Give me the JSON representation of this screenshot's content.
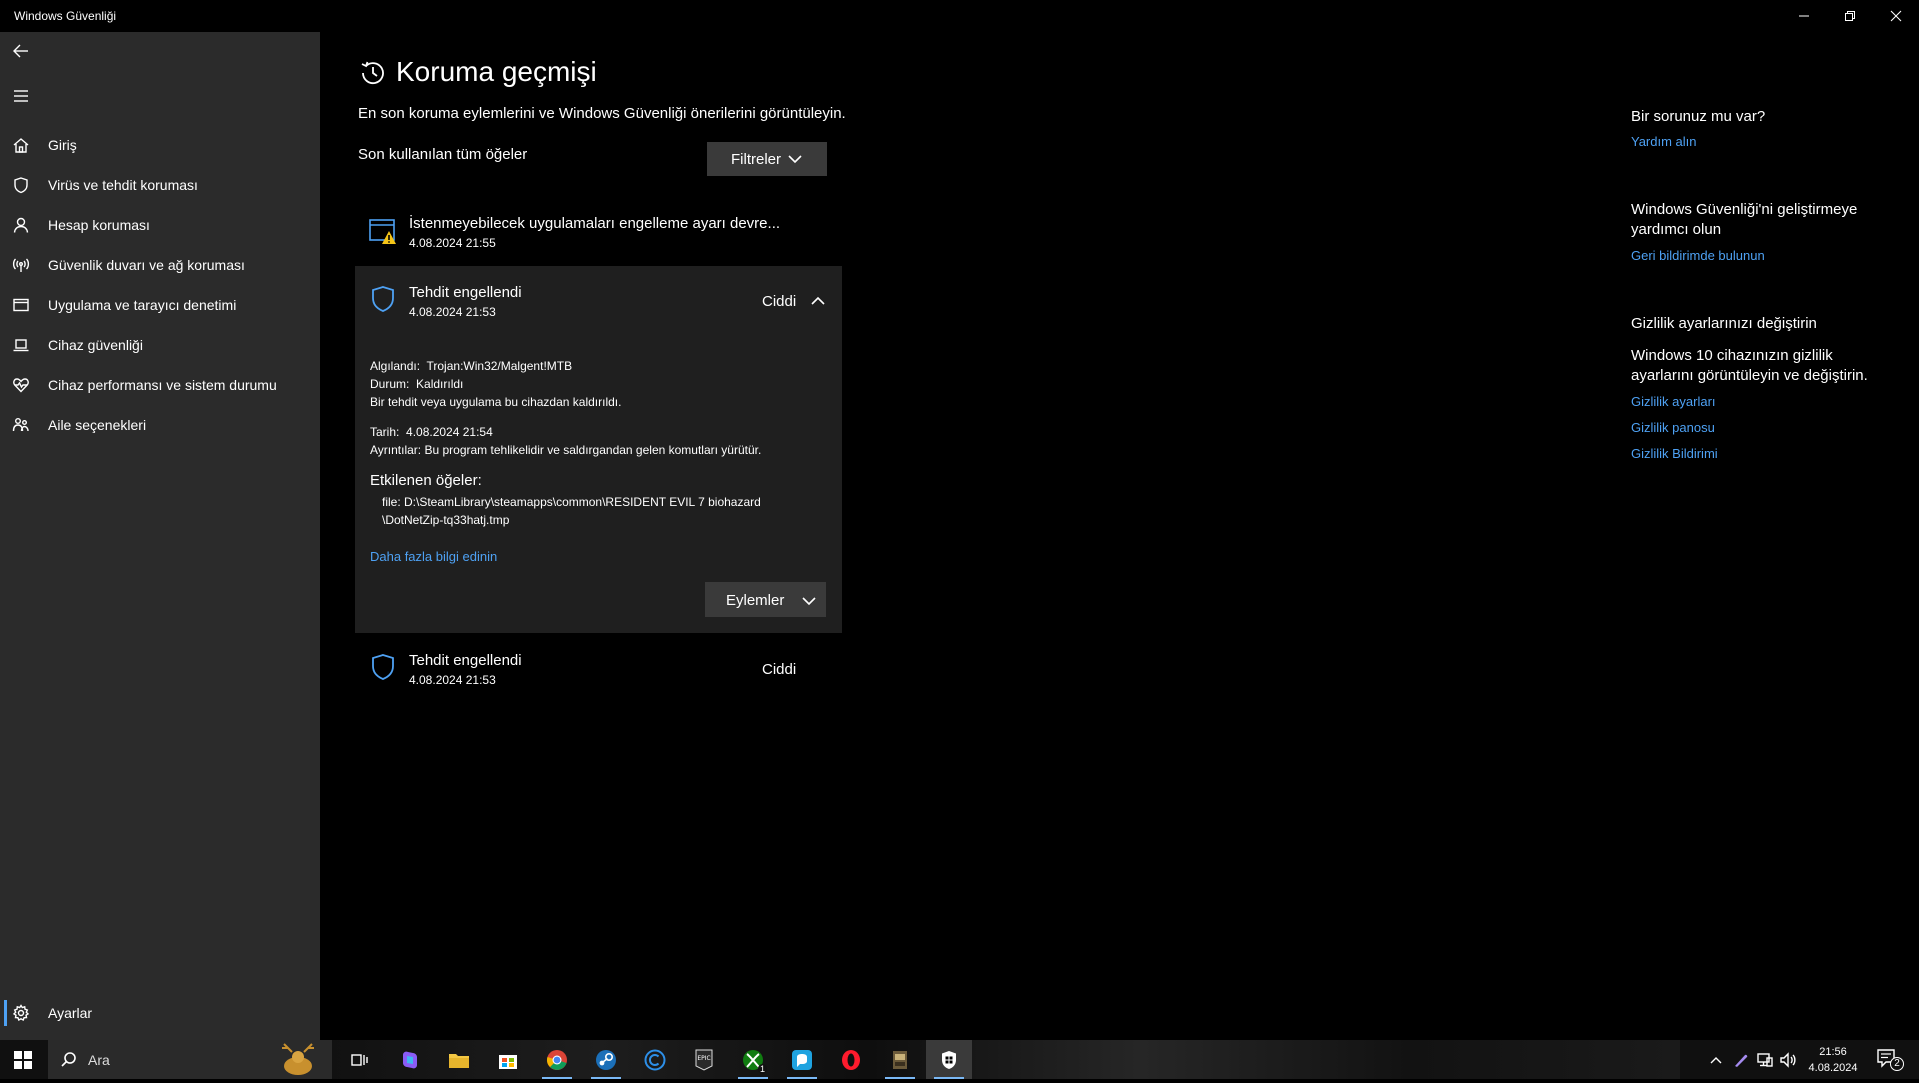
{
  "window": {
    "title": "Windows Güvenliği"
  },
  "sidebar": {
    "items": [
      {
        "label": "Giriş",
        "icon": "home-icon"
      },
      {
        "label": "Virüs ve tehdit koruması",
        "icon": "shield-icon"
      },
      {
        "label": "Hesap koruması",
        "icon": "person-icon"
      },
      {
        "label": "Güvenlik duvarı ve ağ koruması",
        "icon": "antenna-icon"
      },
      {
        "label": "Uygulama ve tarayıcı denetimi",
        "icon": "browser-window-icon"
      },
      {
        "label": "Cihaz güvenliği",
        "icon": "laptop-icon"
      },
      {
        "label": "Cihaz performansı ve sistem durumu",
        "icon": "heart-pulse-icon"
      },
      {
        "label": "Aile seçenekleri",
        "icon": "family-icon"
      }
    ],
    "settings_label": "Ayarlar"
  },
  "main": {
    "title": "Koruma geçmişi",
    "subtitle": "En son koruma eylemlerini ve Windows Güvenliği önerilerini görüntüleyin.",
    "section_label": "Son kullanılan tüm öğeler",
    "filters_label": "Filtreler",
    "history": [
      {
        "title": "İstenmeyebilecek uygulamaları engelleme ayarı devre...",
        "time": "4.08.2024 21:55",
        "icon": "warning-window-icon"
      },
      {
        "title": "Tehdit engellendi",
        "time": "4.08.2024 21:53",
        "severity": "Ciddi",
        "icon": "shield-outline-icon",
        "expanded": true,
        "details": {
          "detected_label": "Algılandı:",
          "detected_value": "Trojan:Win32/Malgent!MTB",
          "status_label": "Durum:",
          "status_value": "Kaldırıldı",
          "status_note": "Bir tehdit veya uygulama bu cihazdan kaldırıldı.",
          "date_label": "Tarih:",
          "date_value": "4.08.2024 21:54",
          "details_label": "Ayrıntılar:",
          "details_value": "Bu program tehlikelidir ve saldırgandan gelen komutları yürütür.",
          "affected_heading": "Etkilenen öğeler:",
          "affected_line1": "file: D:\\SteamLibrary\\steamapps\\common\\RESIDENT EVIL 7 biohazard",
          "affected_line2": "\\DotNetZip-tq33hatj.tmp",
          "more_info_link": "Daha fazla bilgi edinin",
          "actions_label": "Eylemler"
        }
      },
      {
        "title": "Tehdit engellendi",
        "time": "4.08.2024 21:53",
        "severity": "Ciddi",
        "icon": "shield-outline-icon"
      }
    ]
  },
  "right_panel": {
    "help_heading": "Bir sorunuz mu var?",
    "help_link": "Yardım alın",
    "improve_heading": "Windows Güvenliği'ni geliştirmeye yardımcı olun",
    "improve_link": "Geri bildirimde bulunun",
    "privacy_heading": "Gizlilik ayarlarınızı değiştirin",
    "privacy_text": "Windows 10 cihazınızın gizlilik ayarlarını görüntüleyin ve değiştirin.",
    "privacy_links": [
      "Gizlilik ayarları",
      "Gizlilik panosu",
      "Gizlilik Bildirimi"
    ]
  },
  "taskbar": {
    "search_placeholder": "Ara",
    "time": "21:56",
    "date": "4.08.2024",
    "xbox_badge": "1",
    "notification_count": "2",
    "icons": [
      "task-view-icon",
      "copilot-icon",
      "file-explorer-icon",
      "store-icon",
      "chrome-icon",
      "steam-icon",
      "ccleaner-icon",
      "epic-games-icon",
      "xbox-icon",
      "messenger-icon",
      "opera-icon",
      "game-icon",
      "windows-security-icon"
    ]
  },
  "colors": {
    "accent": "#4ea1f3",
    "sidebar_bg": "#2b2b2b",
    "card_bg": "#1f1f1f",
    "button_bg": "#3a3a3a"
  }
}
